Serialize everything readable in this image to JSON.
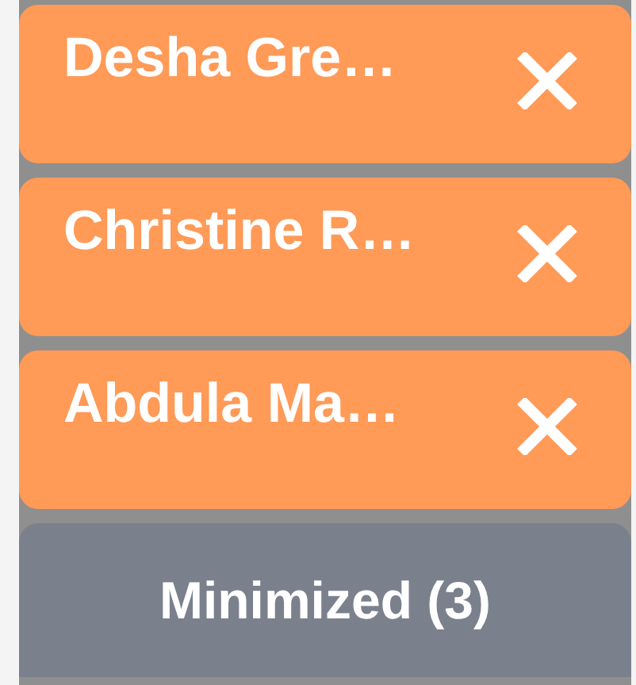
{
  "chats": [
    {
      "name": "Desha Gre…"
    },
    {
      "name": "Christine R…"
    },
    {
      "name": "Abdula Ma…"
    }
  ],
  "minimized_bar": {
    "label": "Minimized (3)"
  }
}
